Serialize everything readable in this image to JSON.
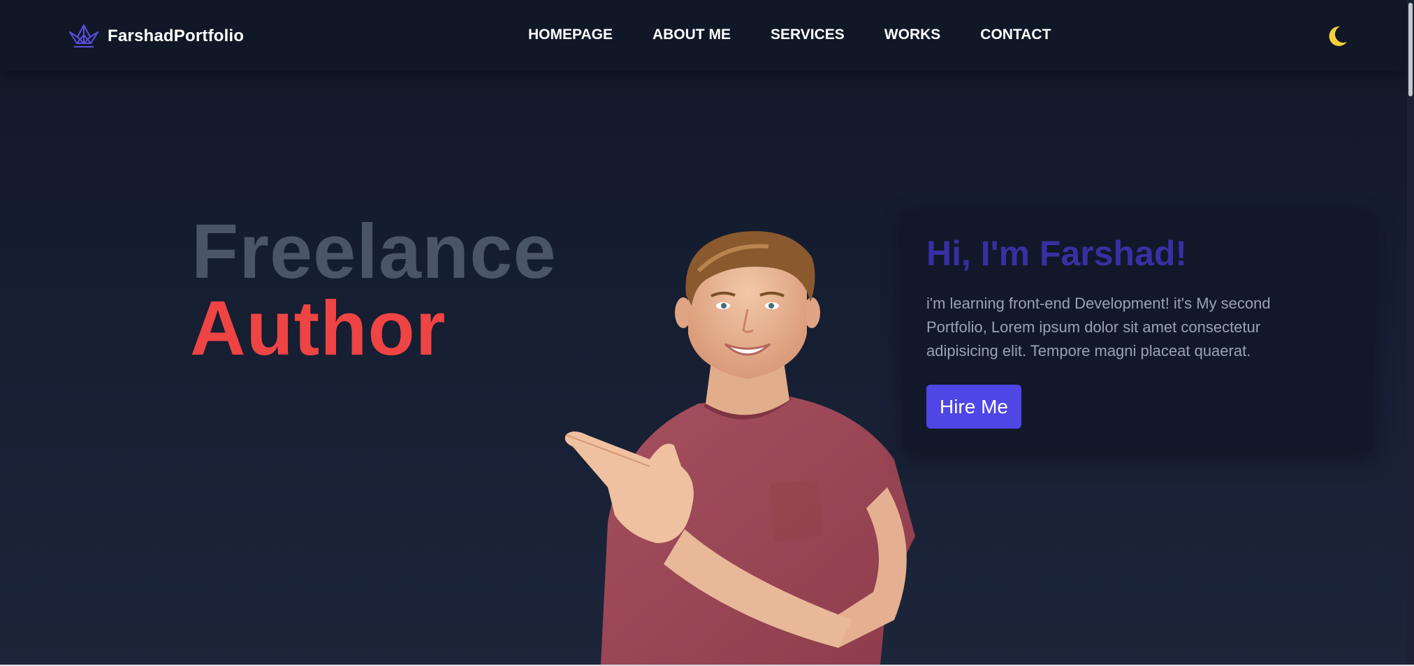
{
  "brand": {
    "name": "FarshadPortfolio",
    "icon": "crown-logo-icon",
    "color": "#4f46e5"
  },
  "nav": {
    "items": [
      {
        "label": "HOMEPAGE"
      },
      {
        "label": "ABOUT ME"
      },
      {
        "label": "SERVICES"
      },
      {
        "label": "WORKS"
      },
      {
        "label": "CONTACT"
      }
    ]
  },
  "theme_toggle": {
    "icon": "moon-icon",
    "color": "#f5cf3b"
  },
  "hero": {
    "line1": "Freelance",
    "line2": "Author",
    "line1_color": "#4a5566",
    "line2_color": "#ef4444"
  },
  "intro": {
    "title": "Hi, I'm Farshad!",
    "text": "i'm learning front-end Development! it's My second Portfolio, Lorem ipsum dolor sit amet consectetur adipisicing elit. Tempore magni placeat quaerat.",
    "button_label": "Hire Me",
    "title_color": "#3730a3",
    "button_color": "#4f46e5"
  },
  "colors": {
    "background": "#141b2d",
    "header_background": "#101727",
    "card_background": "#111829"
  }
}
